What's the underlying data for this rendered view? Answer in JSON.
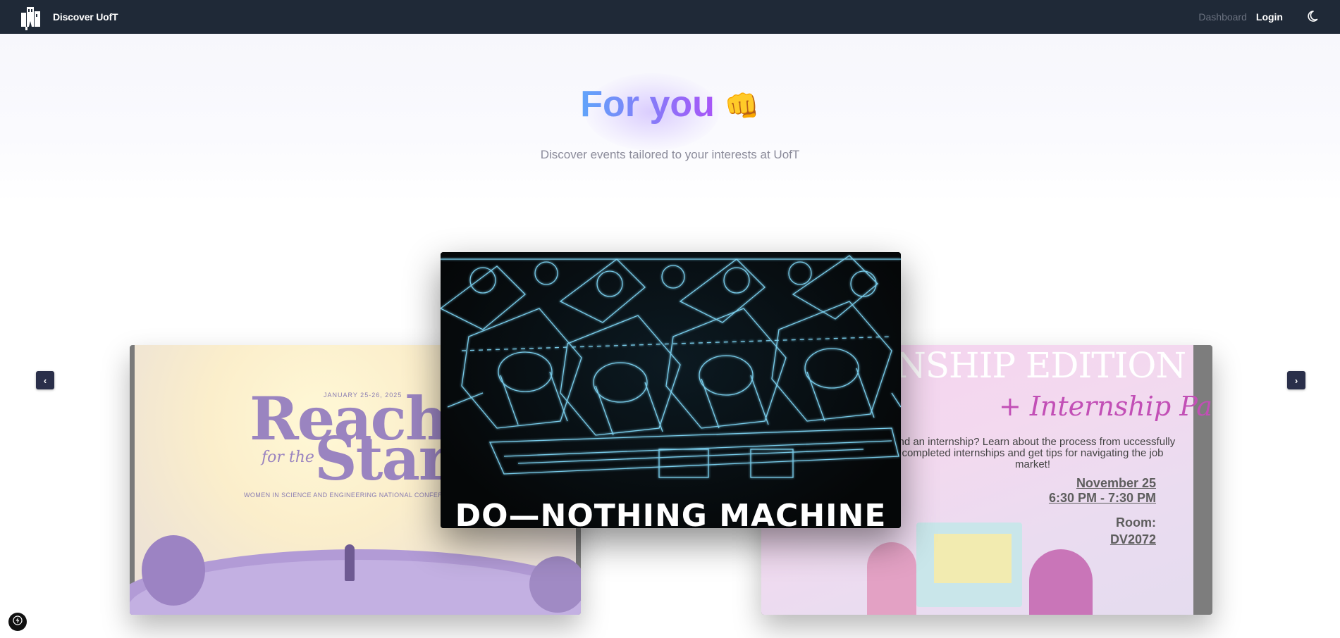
{
  "navbar": {
    "brand": "Discover UofT",
    "dashboard": "Dashboard",
    "login": "Login",
    "theme_icon": "moon-icon",
    "logo_icon": "building-logo-icon"
  },
  "hero": {
    "title": "For you",
    "emoji": "👊",
    "subtitle": "Discover events tailored to your interests at UofT"
  },
  "carousel": {
    "prev_label": "‹",
    "next_label": "›",
    "slides": [
      {
        "position": "left",
        "date": "JANUARY 25-26, 2025",
        "title_line1": "Reachin",
        "title_mid": "for the",
        "title_line2": "Stars",
        "subtitle": "WOMEN IN SCIENCE AND ENGINEERING NATIONAL CONFERENC"
      },
      {
        "position": "center",
        "caption": "DO—NOTHING MACHINE"
      },
      {
        "position": "right",
        "title": "NSHIP EDITION",
        "panel": "+ Internship Panel",
        "description": "land an internship? Learn about the process from uccessfully completed internships and get tips for navigating the job market!",
        "date": "November 25",
        "time": "6:30 PM - 7:30 PM",
        "room_label": "Room:",
        "room": "DV2072"
      }
    ]
  },
  "colors": {
    "navbar_bg": "#1f2937",
    "title_gradient_start": "#60a5fa",
    "title_gradient_end": "#a855f7",
    "arrow_bg": "#2a2f4a"
  }
}
